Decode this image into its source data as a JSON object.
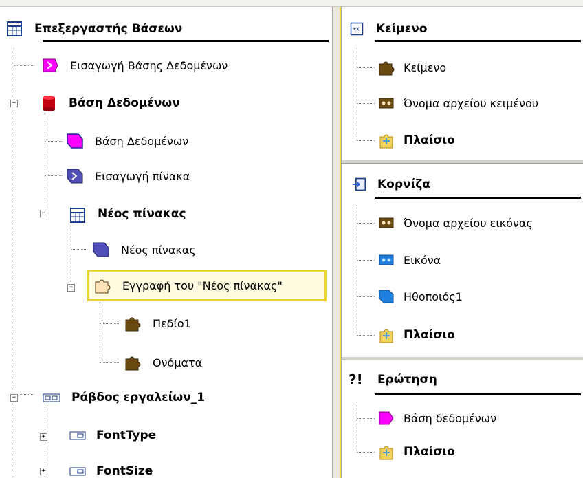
{
  "left": {
    "header": "Επεξεργαστής Βάσεων",
    "items": {
      "import_db": "Εισαγωγή Βάσης Δεδομένων",
      "database_group": "Βάση Δεδομένων",
      "database": "Βάση Δεδομένων",
      "import_table": "Εισαγωγή πίνακα",
      "new_table_group": "Νέος πίνακας",
      "new_table": "Νέος πίνακας",
      "record": "Εγγραφή του \"Νέος πίνακας\"",
      "field1": "Πεδίο1",
      "names": "Ονόματα",
      "toolbar": "Ράβδος εργαλείων_1",
      "fonttype": "FontType",
      "fontsize": "FontSize"
    }
  },
  "right": {
    "text_panel": {
      "header": "Κείμενο",
      "items": [
        "Κείμενο",
        "Όνομα αρχείου κειμένου",
        "Πλαίσιο"
      ]
    },
    "frame_panel": {
      "header": "Κορνίζα",
      "items": [
        "Όνομα αρχείου εικόνας",
        "Εικόνα",
        "Ηθοποιός1",
        "Πλαίσιο"
      ]
    },
    "question_panel": {
      "header": "Ερώτηση",
      "items": [
        "Βάση δεδομένων",
        "Πλαίσιο"
      ]
    }
  },
  "colors": {
    "magenta": "#ff00ff",
    "db_red": "#c00010",
    "blue_purple": "#5050b8",
    "puzzle_brown": "#6b4a12",
    "puzzle_tan": "#fde2b8",
    "blue": "#2080e0",
    "selection": "#e8d23a"
  }
}
